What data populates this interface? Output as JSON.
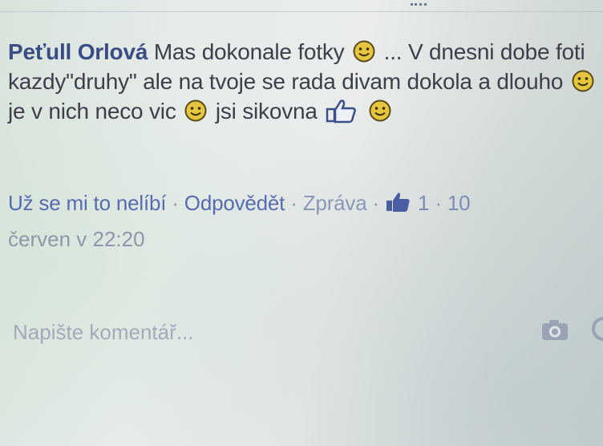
{
  "comment": {
    "author": "Peťull Orlová",
    "text_parts": [
      "Mas dokonale fotky",
      "... V dnesni dobe foti kazdy\"druhy\" ale na tvoje se rada divam dokola a dlouho",
      "je v nich neco vic",
      "jsi sikovna"
    ]
  },
  "actions": {
    "unlike": "Už se mi to nelíbí",
    "reply": "Odpovědět",
    "report": "Zpráva",
    "separator": "·",
    "like_count": "1",
    "date_fragment": "10",
    "timestamp": "červen v 22:20"
  },
  "composer": {
    "placeholder": "Napište komentář..."
  },
  "colors": {
    "author": "#3a4c84",
    "link": "#5a6ab0",
    "text": "#3d3f49",
    "meta": "#8d97a8"
  },
  "icons": [
    "smiley-icon",
    "thumbs-up-icon",
    "like-icon",
    "camera-icon",
    "sticker-icon"
  ]
}
